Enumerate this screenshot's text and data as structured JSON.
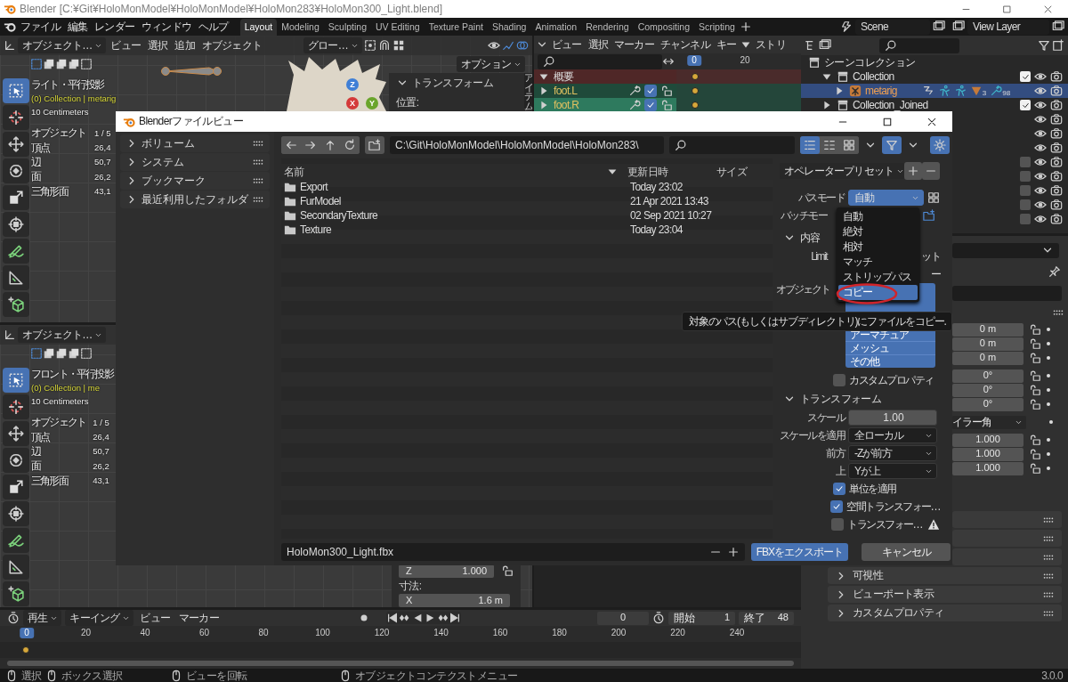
{
  "window": {
    "title": "Blender [C:¥Git¥HoloMonModel¥HoloMonModel¥HoloMon283¥HoloMon300_Light.blend]"
  },
  "menu": [
    "ファイル",
    "編集",
    "レンダー",
    "ウィンドウ",
    "ヘルプ"
  ],
  "workspaces": [
    {
      "label": "Layout",
      "selected": true
    },
    {
      "label": "Modeling",
      "selected": false
    },
    {
      "label": "Sculpting",
      "selected": false
    },
    {
      "label": "UV Editing",
      "selected": false
    },
    {
      "label": "Texture Paint",
      "selected": false
    },
    {
      "label": "Shading",
      "selected": false
    },
    {
      "label": "Animation",
      "selected": false
    },
    {
      "label": "Rendering",
      "selected": false
    },
    {
      "label": "Compositing",
      "selected": false
    },
    {
      "label": "Scripting",
      "selected": false
    }
  ],
  "scene": "Scene",
  "view_layer": "View Layer",
  "viewport_top": {
    "mode": "オブジェクト…",
    "menus": [
      "ビュー",
      "選択",
      "追加",
      "オブジェクト"
    ],
    "orientation": "グロー…",
    "options": "オプション",
    "view": "ライト・平行投影",
    "collection": "(0) Collection | metarig",
    "grid_scale": "10 Centimeters",
    "stats": [
      {
        "label": "オブジェクト",
        "value": "1 / 5"
      },
      {
        "label": "頂点",
        "value": "26,4"
      },
      {
        "label": "辺",
        "value": "50,7"
      },
      {
        "label": "面",
        "value": "26,2"
      },
      {
        "label": "三角形面",
        "value": "43,1"
      }
    ],
    "gizmo": [
      "Z",
      "X",
      "Y"
    ],
    "panel_title": "トランスフォーム",
    "panel_label": "位置:",
    "sidebar_tab": "アイテム"
  },
  "dopesheet": {
    "menus": [
      "ビュー",
      "選択",
      "マーカー",
      "チャンネル",
      "キー"
    ],
    "strip": "ストリ",
    "frames": [
      "0",
      "20"
    ],
    "channels": [
      {
        "name": "概要",
        "kind": "summary",
        "selected": false
      },
      {
        "name": "foot.L",
        "kind": "bone",
        "selected": false
      },
      {
        "name": "foot.R",
        "kind": "bone",
        "selected": true
      }
    ]
  },
  "outliner": {
    "items": [
      {
        "name": "シーンコレクション",
        "kind": "scene",
        "children": [
          {
            "name": "Collection",
            "kind": "collection",
            "checked": true,
            "selected": false,
            "children": [
              {
                "name": "metarig",
                "kind": "armature",
                "selected": true,
                "badges": [
                  "3",
                  "98"
                ]
              }
            ]
          },
          {
            "name": "Collection_Joined",
            "kind": "collection",
            "checked": true,
            "selected": false
          }
        ]
      }
    ],
    "more_rows": [
      {
        "kind": "plain"
      },
      {
        "kind": "plain"
      },
      {
        "kind": "plain"
      },
      {
        "kind": "toggle",
        "checked": false
      },
      {
        "kind": "toggle",
        "checked": false
      },
      {
        "kind": "toggle",
        "checked": false
      },
      {
        "kind": "toggle",
        "checked": false
      },
      {
        "kind": "toggle",
        "checked": false
      }
    ]
  },
  "properties": {
    "location": [
      "0 m",
      "0 m",
      "0 m"
    ],
    "rotation": [
      "0°",
      "0°",
      "0°"
    ],
    "rotation_mode": "イラー角",
    "scale": [
      "1.000",
      "1.000",
      "1.000"
    ],
    "panels": [
      "可視性",
      "ビューポート表示",
      "カスタムプロパティ"
    ]
  },
  "viewport_bottom": {
    "mode": "オブジェクト…",
    "view": "フロント・平行投影",
    "collection": "(0) Collection | me",
    "grid_scale": "10 Centimeters",
    "stats": [
      {
        "label": "オブジェクト",
        "value": "1 / 5"
      },
      {
        "label": "頂点",
        "value": "26,4"
      },
      {
        "label": "辺",
        "value": "50,7"
      },
      {
        "label": "面",
        "value": "26,2"
      },
      {
        "label": "三角形面",
        "value": "43,1"
      }
    ],
    "panel_z": {
      "label": "Z",
      "value": "1.000"
    },
    "dimensions": "寸法:",
    "panel_x": {
      "label": "X",
      "value": "1.6 m"
    }
  },
  "timeline": {
    "menus": [
      "再生",
      "キーイング",
      "ビュー",
      "マーカー"
    ],
    "current": "0",
    "start_label": "開始",
    "start": "1",
    "end_label": "終了",
    "end": "48",
    "ruler": [
      "0",
      "20",
      "40",
      "60",
      "80",
      "100",
      "120",
      "140",
      "160",
      "180",
      "200",
      "220",
      "240"
    ]
  },
  "status_bar": {
    "hints": [
      "選択",
      "ボックス選択",
      "ビューを回転",
      "オブジェクトコンテクストメニュー"
    ],
    "version": "3.0.0"
  },
  "dialog": {
    "title": "Blenderファイルビュー",
    "sidebar": [
      {
        "label": "ボリューム",
        "expanded": false
      },
      {
        "label": "システム",
        "expanded": false
      },
      {
        "label": "ブックマーク",
        "expanded": false
      },
      {
        "label": "最近利用したフォルダ",
        "expanded": false
      }
    ],
    "path": "C:\\Git\\HoloMonModel\\HoloMonModel\\HoloMon283\\",
    "view_modes": [
      {
        "kind": "list",
        "selected": true
      },
      {
        "kind": "columns",
        "selected": false
      },
      {
        "kind": "thumbnails",
        "selected": false
      }
    ],
    "filter_on": true,
    "columns": [
      "名前",
      "更新日時",
      "サイズ"
    ],
    "files": [
      {
        "name": "Export",
        "date": "Today 23:02"
      },
      {
        "name": "FurModel",
        "date": "21 Apr 2021 13:43"
      },
      {
        "name": "SecondaryTexture",
        "date": "02 Sep 2021 10:27"
      },
      {
        "name": "Texture",
        "date": "Today 23:04"
      }
    ],
    "filename": "HoloMon300_Light.fbx",
    "export": "FBXをエクスポート",
    "cancel": "キャンセル",
    "preset": "オペレータープリセット",
    "path_mode": {
      "label": "パスモード",
      "value": "自動"
    },
    "batch_label": "バッチモー",
    "include": {
      "title": "内容",
      "expanded": true
    },
    "limit_label": "Limit",
    "limit_tail": "ット",
    "fragment": "ー",
    "object_label": "オブジェクト",
    "object_types": [
      {
        "label": "アーマチュア",
        "selected": true
      },
      {
        "label": "メッシュ",
        "selected": true
      },
      {
        "label": "その他",
        "selected": true
      }
    ],
    "custom_props": {
      "label": "カスタムプロパティ",
      "checked": false
    },
    "transform": {
      "title": "トランスフォーム",
      "expanded": true
    },
    "scale": {
      "label": "スケール",
      "value": "1.00"
    },
    "selects": [
      {
        "label": "スケールを適用",
        "value": "全ローカル"
      },
      {
        "label": "前方",
        "value": "-Zが前方"
      },
      {
        "label": "上",
        "value": "Yが上"
      }
    ],
    "checks": [
      {
        "label": "単位を適用",
        "checked": true,
        "warning": false
      },
      {
        "label": "空間トランスフォー…",
        "checked": true,
        "warning": false
      },
      {
        "label": "トランスフォー…",
        "checked": false,
        "warning": true
      }
    ],
    "menu": [
      {
        "label": "自動",
        "selected": false
      },
      {
        "label": "絶対",
        "selected": false
      },
      {
        "label": "相対",
        "selected": false
      },
      {
        "label": "マッチ",
        "selected": false
      },
      {
        "label": "ストリップパス",
        "selected": false
      },
      {
        "label": "コピー",
        "selected": true
      }
    ],
    "tooltip": "対象のパス(もしくはサブディレクトリ)にファイルをコピー."
  }
}
